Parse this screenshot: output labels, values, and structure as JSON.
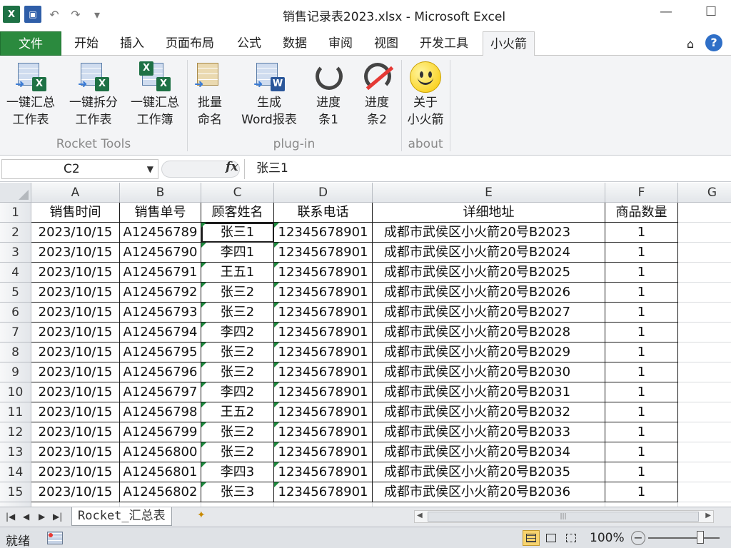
{
  "window": {
    "title": "销售记录表2023.xlsx  -  Microsoft Excel"
  },
  "qat": {
    "app_icon": "X",
    "undo_icon": "↶",
    "redo_icon": "↷",
    "more_icon": "▾"
  },
  "tabs": [
    {
      "label": "文件"
    },
    {
      "label": "开始"
    },
    {
      "label": "插入"
    },
    {
      "label": "页面布局"
    },
    {
      "label": "公式"
    },
    {
      "label": "数据"
    },
    {
      "label": "审阅"
    },
    {
      "label": "视图"
    },
    {
      "label": "开发工具"
    },
    {
      "label": "小火箭"
    }
  ],
  "ribbon": {
    "groups": [
      {
        "label": "Rocket Tools"
      },
      {
        "label": "plug-in"
      },
      {
        "label": "about"
      }
    ],
    "buttons": [
      {
        "line1": "一键汇总",
        "line2": "工作表",
        "icon": "merge-sheets-icon"
      },
      {
        "line1": "一键拆分",
        "line2": "工作表",
        "icon": "split-sheets-icon"
      },
      {
        "line1": "一键汇总",
        "line2": "工作簿",
        "icon": "merge-workbooks-icon"
      },
      {
        "line1": "批量",
        "line2": "命名",
        "icon": "batch-rename-icon"
      },
      {
        "line1": "生成",
        "line2": "Word报表",
        "icon": "word-report-icon"
      },
      {
        "line1": "进度",
        "line2": "条1",
        "icon": "progress-1-icon"
      },
      {
        "line1": "进度",
        "line2": "条2",
        "icon": "progress-2-icon"
      },
      {
        "line1": "关于",
        "line2": "小火箭",
        "icon": "smiley-icon"
      }
    ]
  },
  "formula_bar": {
    "name_box": "C2",
    "fx": "fx",
    "value": "张三1"
  },
  "grid": {
    "columns": [
      "A",
      "B",
      "C",
      "D",
      "E",
      "F",
      "G"
    ],
    "header_row": [
      "销售时间",
      "销售单号",
      "顾客姓名",
      "联系电话",
      "详细地址",
      "商品数量"
    ],
    "rows": [
      [
        "2023/10/15",
        "A12456789",
        "张三1",
        "12345678901",
        "成都市武侯区小火箭20号B2023",
        "1"
      ],
      [
        "2023/10/15",
        "A12456790",
        "李四1",
        "12345678901",
        "成都市武侯区小火箭20号B2024",
        "1"
      ],
      [
        "2023/10/15",
        "A12456791",
        "王五1",
        "12345678901",
        "成都市武侯区小火箭20号B2025",
        "1"
      ],
      [
        "2023/10/15",
        "A12456792",
        "张三2",
        "12345678901",
        "成都市武侯区小火箭20号B2026",
        "1"
      ],
      [
        "2023/10/15",
        "A12456793",
        "张三2",
        "12345678901",
        "成都市武侯区小火箭20号B2027",
        "1"
      ],
      [
        "2023/10/15",
        "A12456794",
        "李四2",
        "12345678901",
        "成都市武侯区小火箭20号B2028",
        "1"
      ],
      [
        "2023/10/15",
        "A12456795",
        "张三2",
        "12345678901",
        "成都市武侯区小火箭20号B2029",
        "1"
      ],
      [
        "2023/10/15",
        "A12456796",
        "张三2",
        "12345678901",
        "成都市武侯区小火箭20号B2030",
        "1"
      ],
      [
        "2023/10/15",
        "A12456797",
        "李四2",
        "12345678901",
        "成都市武侯区小火箭20号B2031",
        "1"
      ],
      [
        "2023/10/15",
        "A12456798",
        "王五2",
        "12345678901",
        "成都市武侯区小火箭20号B2032",
        "1"
      ],
      [
        "2023/10/15",
        "A12456799",
        "张三2",
        "12345678901",
        "成都市武侯区小火箭20号B2033",
        "1"
      ],
      [
        "2023/10/15",
        "A12456800",
        "张三2",
        "12345678901",
        "成都市武侯区小火箭20号B2034",
        "1"
      ],
      [
        "2023/10/15",
        "A12456801",
        "李四3",
        "12345678901",
        "成都市武侯区小火箭20号B2035",
        "1"
      ],
      [
        "2023/10/15",
        "A12456802",
        "张三3",
        "12345678901",
        "成都市武侯区小火箭20号B2036",
        "1"
      ]
    ]
  },
  "sheet_tabs": {
    "active": "Rocket_汇总表"
  },
  "status": {
    "ready": "就绪",
    "zoom": "100%",
    "zoom_minus": "−",
    "zoom_plus": "+"
  }
}
